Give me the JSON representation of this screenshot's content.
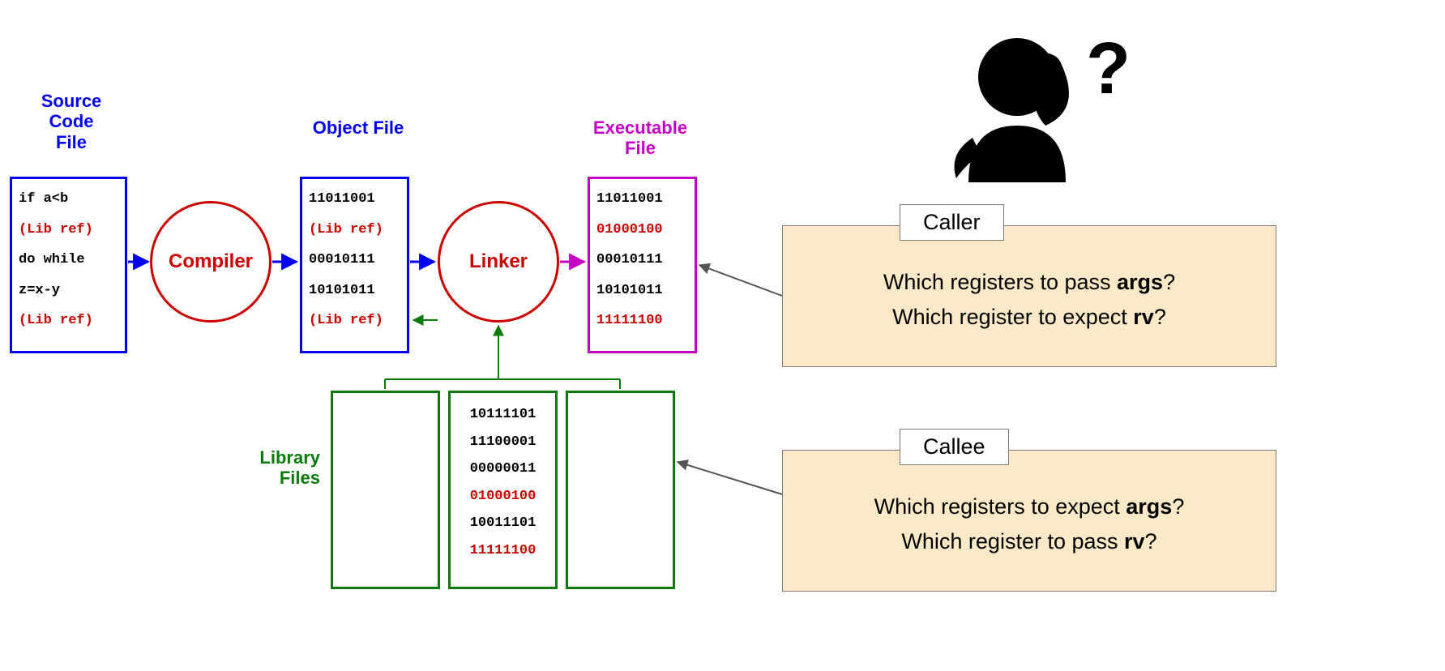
{
  "labels": {
    "source": "Source\nCode\nFile",
    "object": "Object File",
    "executable": "Executable\nFile",
    "library": "Library\nFiles",
    "compiler": "Compiler",
    "linker": "Linker"
  },
  "source_lines": [
    {
      "text": "if a<b",
      "cls": "blk"
    },
    {
      "text": "(Lib ref)",
      "cls": "red"
    },
    {
      "text": "do while",
      "cls": "blk"
    },
    {
      "text": "z=x-y",
      "cls": "blk"
    },
    {
      "text": "(Lib ref)",
      "cls": "red"
    }
  ],
  "object_lines": [
    {
      "text": "11011001",
      "cls": "blk"
    },
    {
      "text": "(Lib ref)",
      "cls": "red"
    },
    {
      "text": "00010111",
      "cls": "blk"
    },
    {
      "text": "10101011",
      "cls": "blk"
    },
    {
      "text": "(Lib ref)",
      "cls": "red"
    }
  ],
  "exe_lines": [
    {
      "text": "11011001",
      "cls": "blk"
    },
    {
      "text": "01000100",
      "cls": "red"
    },
    {
      "text": "00010111",
      "cls": "blk"
    },
    {
      "text": "10101011",
      "cls": "blk"
    },
    {
      "text": "11111100",
      "cls": "red"
    }
  ],
  "lib_lines": [
    {
      "text": "10111101",
      "cls": "blk"
    },
    {
      "text": "11100001",
      "cls": "blk"
    },
    {
      "text": "00000011",
      "cls": "blk"
    },
    {
      "text": "01000100",
      "cls": "red"
    },
    {
      "text": "10011101",
      "cls": "blk"
    },
    {
      "text": "11111100",
      "cls": "red"
    }
  ],
  "caller": {
    "title": "Caller",
    "q1_a": "Which registers to pass ",
    "q1_b": "args",
    "q1_c": "?",
    "q2_a": "Which register to expect ",
    "q2_b": "rv",
    "q2_c": "?"
  },
  "callee": {
    "title": "Callee",
    "q1_a": "Which registers to expect ",
    "q1_b": "args",
    "q1_c": "?",
    "q2_a": "Which register to pass ",
    "q2_b": "rv",
    "q2_c": "?"
  }
}
